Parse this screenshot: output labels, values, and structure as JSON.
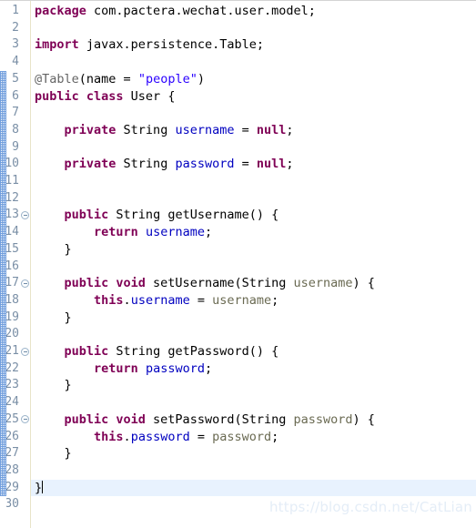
{
  "editor": {
    "name": "java-source-editor",
    "language": "Java",
    "total_lines": 30,
    "current_line": 29,
    "colors": {
      "background": "#ffffff",
      "keyword": "#7f0055",
      "string": "#2a00ff",
      "field": "#0000c0",
      "parameter": "#6a6a52",
      "annotation": "#646464",
      "plain_text": "#000000",
      "line_number": "#7a8fa6",
      "current_line_highlight": "#e8f2fe",
      "gutter_separator": "#e8e4c8",
      "change_bar": "#5a8fd8",
      "watermark": "#e4edf7"
    }
  },
  "gutter": {
    "line_numbers": [
      1,
      2,
      3,
      4,
      5,
      6,
      7,
      8,
      9,
      10,
      11,
      12,
      13,
      14,
      15,
      16,
      17,
      18,
      19,
      20,
      21,
      22,
      23,
      24,
      25,
      26,
      27,
      28,
      29,
      30
    ],
    "fold_marker_lines": [
      13,
      17,
      21,
      25
    ],
    "change_bar_start_line": 5,
    "change_bar_end_line": 29
  },
  "code": {
    "lines": [
      {
        "n": 1,
        "tokens": [
          {
            "t": "package",
            "c": "kw"
          },
          {
            "t": " com.pactera.wechat.user.model;",
            "c": "plain"
          }
        ]
      },
      {
        "n": 2,
        "tokens": []
      },
      {
        "n": 3,
        "tokens": [
          {
            "t": "import",
            "c": "kw"
          },
          {
            "t": " javax.persistence.Table;",
            "c": "plain"
          }
        ]
      },
      {
        "n": 4,
        "tokens": []
      },
      {
        "n": 5,
        "tokens": [
          {
            "t": "@Table",
            "c": "anno"
          },
          {
            "t": "(name = ",
            "c": "plain"
          },
          {
            "t": "\"people\"",
            "c": "str"
          },
          {
            "t": ")",
            "c": "plain"
          }
        ]
      },
      {
        "n": 6,
        "tokens": [
          {
            "t": "public class",
            "c": "kw"
          },
          {
            "t": " User {",
            "c": "plain"
          }
        ]
      },
      {
        "n": 7,
        "tokens": []
      },
      {
        "n": 8,
        "tokens": [
          {
            "t": "    ",
            "c": "plain"
          },
          {
            "t": "private",
            "c": "kw"
          },
          {
            "t": " String ",
            "c": "plain"
          },
          {
            "t": "username",
            "c": "fld"
          },
          {
            "t": " = ",
            "c": "plain"
          },
          {
            "t": "null",
            "c": "kw"
          },
          {
            "t": ";",
            "c": "plain"
          }
        ]
      },
      {
        "n": 9,
        "tokens": []
      },
      {
        "n": 10,
        "tokens": [
          {
            "t": "    ",
            "c": "plain"
          },
          {
            "t": "private",
            "c": "kw"
          },
          {
            "t": " String ",
            "c": "plain"
          },
          {
            "t": "password",
            "c": "fld"
          },
          {
            "t": " = ",
            "c": "plain"
          },
          {
            "t": "null",
            "c": "kw"
          },
          {
            "t": ";",
            "c": "plain"
          }
        ]
      },
      {
        "n": 11,
        "tokens": []
      },
      {
        "n": 12,
        "tokens": []
      },
      {
        "n": 13,
        "tokens": [
          {
            "t": "    ",
            "c": "plain"
          },
          {
            "t": "public",
            "c": "kw"
          },
          {
            "t": " String getUsername() {",
            "c": "plain"
          }
        ]
      },
      {
        "n": 14,
        "tokens": [
          {
            "t": "        ",
            "c": "plain"
          },
          {
            "t": "return",
            "c": "kw"
          },
          {
            "t": " ",
            "c": "plain"
          },
          {
            "t": "username",
            "c": "fld"
          },
          {
            "t": ";",
            "c": "plain"
          }
        ]
      },
      {
        "n": 15,
        "tokens": [
          {
            "t": "    }",
            "c": "plain"
          }
        ]
      },
      {
        "n": 16,
        "tokens": []
      },
      {
        "n": 17,
        "tokens": [
          {
            "t": "    ",
            "c": "plain"
          },
          {
            "t": "public void",
            "c": "kw"
          },
          {
            "t": " setUsername(String ",
            "c": "plain"
          },
          {
            "t": "username",
            "c": "param"
          },
          {
            "t": ") {",
            "c": "plain"
          }
        ]
      },
      {
        "n": 18,
        "tokens": [
          {
            "t": "        ",
            "c": "plain"
          },
          {
            "t": "this",
            "c": "kw"
          },
          {
            "t": ".",
            "c": "plain"
          },
          {
            "t": "username",
            "c": "fld"
          },
          {
            "t": " = ",
            "c": "plain"
          },
          {
            "t": "username",
            "c": "param"
          },
          {
            "t": ";",
            "c": "plain"
          }
        ]
      },
      {
        "n": 19,
        "tokens": [
          {
            "t": "    }",
            "c": "plain"
          }
        ]
      },
      {
        "n": 20,
        "tokens": []
      },
      {
        "n": 21,
        "tokens": [
          {
            "t": "    ",
            "c": "plain"
          },
          {
            "t": "public",
            "c": "kw"
          },
          {
            "t": " String getPassword() {",
            "c": "plain"
          }
        ]
      },
      {
        "n": 22,
        "tokens": [
          {
            "t": "        ",
            "c": "plain"
          },
          {
            "t": "return",
            "c": "kw"
          },
          {
            "t": " ",
            "c": "plain"
          },
          {
            "t": "password",
            "c": "fld"
          },
          {
            "t": ";",
            "c": "plain"
          }
        ]
      },
      {
        "n": 23,
        "tokens": [
          {
            "t": "    }",
            "c": "plain"
          }
        ]
      },
      {
        "n": 24,
        "tokens": []
      },
      {
        "n": 25,
        "tokens": [
          {
            "t": "    ",
            "c": "plain"
          },
          {
            "t": "public void",
            "c": "kw"
          },
          {
            "t": " setPassword(String ",
            "c": "plain"
          },
          {
            "t": "password",
            "c": "param"
          },
          {
            "t": ") {",
            "c": "plain"
          }
        ]
      },
      {
        "n": 26,
        "tokens": [
          {
            "t": "        ",
            "c": "plain"
          },
          {
            "t": "this",
            "c": "kw"
          },
          {
            "t": ".",
            "c": "plain"
          },
          {
            "t": "password",
            "c": "fld"
          },
          {
            "t": " = ",
            "c": "plain"
          },
          {
            "t": "password",
            "c": "param"
          },
          {
            "t": ";",
            "c": "plain"
          }
        ]
      },
      {
        "n": 27,
        "tokens": [
          {
            "t": "    }",
            "c": "plain"
          }
        ]
      },
      {
        "n": 28,
        "tokens": []
      },
      {
        "n": 29,
        "tokens": [
          {
            "t": "}",
            "c": "plain"
          }
        ],
        "caret_after": true
      },
      {
        "n": 30,
        "tokens": []
      }
    ]
  },
  "watermark": {
    "text": "https://blog.csdn.net/CatLian"
  }
}
